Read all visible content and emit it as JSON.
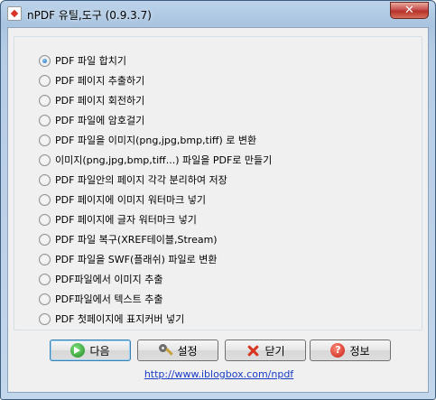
{
  "window": {
    "title": "nPDF 유틸,도구 (0.9.3.7)",
    "close_glyph": "✕"
  },
  "options": [
    {
      "label": "PDF 파일 합치기",
      "checked": true
    },
    {
      "label": "PDF 페이지 추출하기",
      "checked": false
    },
    {
      "label": "PDF 페이지 회전하기",
      "checked": false
    },
    {
      "label": "PDF 파일에 암호걸기",
      "checked": false
    },
    {
      "label": "PDF 파일을 이미지(png,jpg,bmp,tiff) 로 변환",
      "checked": false
    },
    {
      "label": "이미지(png,jpg,bmp,tiff...) 파일을 PDF로 만들기",
      "checked": false
    },
    {
      "label": "PDF 파일안의 페이지 각각 분리하여 저장",
      "checked": false
    },
    {
      "label": "PDF 페이지에 이미지 워터마크 넣기",
      "checked": false
    },
    {
      "label": "PDF 페이지에 글자 워터마크 넣기",
      "checked": false
    },
    {
      "label": "PDF 파일 복구(XREF테이블,Stream)",
      "checked": false
    },
    {
      "label": "PDF 파일을 SWF(플래쉬) 파일로 변환",
      "checked": false
    },
    {
      "label": "PDF파일에서 이미지 추출",
      "checked": false
    },
    {
      "label": "PDF파일에서 텍스트 추출",
      "checked": false
    },
    {
      "label": "PDF 첫페이지에 표지커버 넣기",
      "checked": false
    }
  ],
  "buttons": {
    "next": {
      "label": "다음",
      "icon": "green-arrow-icon"
    },
    "settings": {
      "label": "설정",
      "icon": "wrench-gear-icon"
    },
    "close": {
      "label": "닫기",
      "icon": "red-x-icon"
    },
    "info": {
      "label": "정보",
      "icon": "help-icon",
      "glyph": "?"
    }
  },
  "link": "http://www.iblogbox.com/npdf"
}
